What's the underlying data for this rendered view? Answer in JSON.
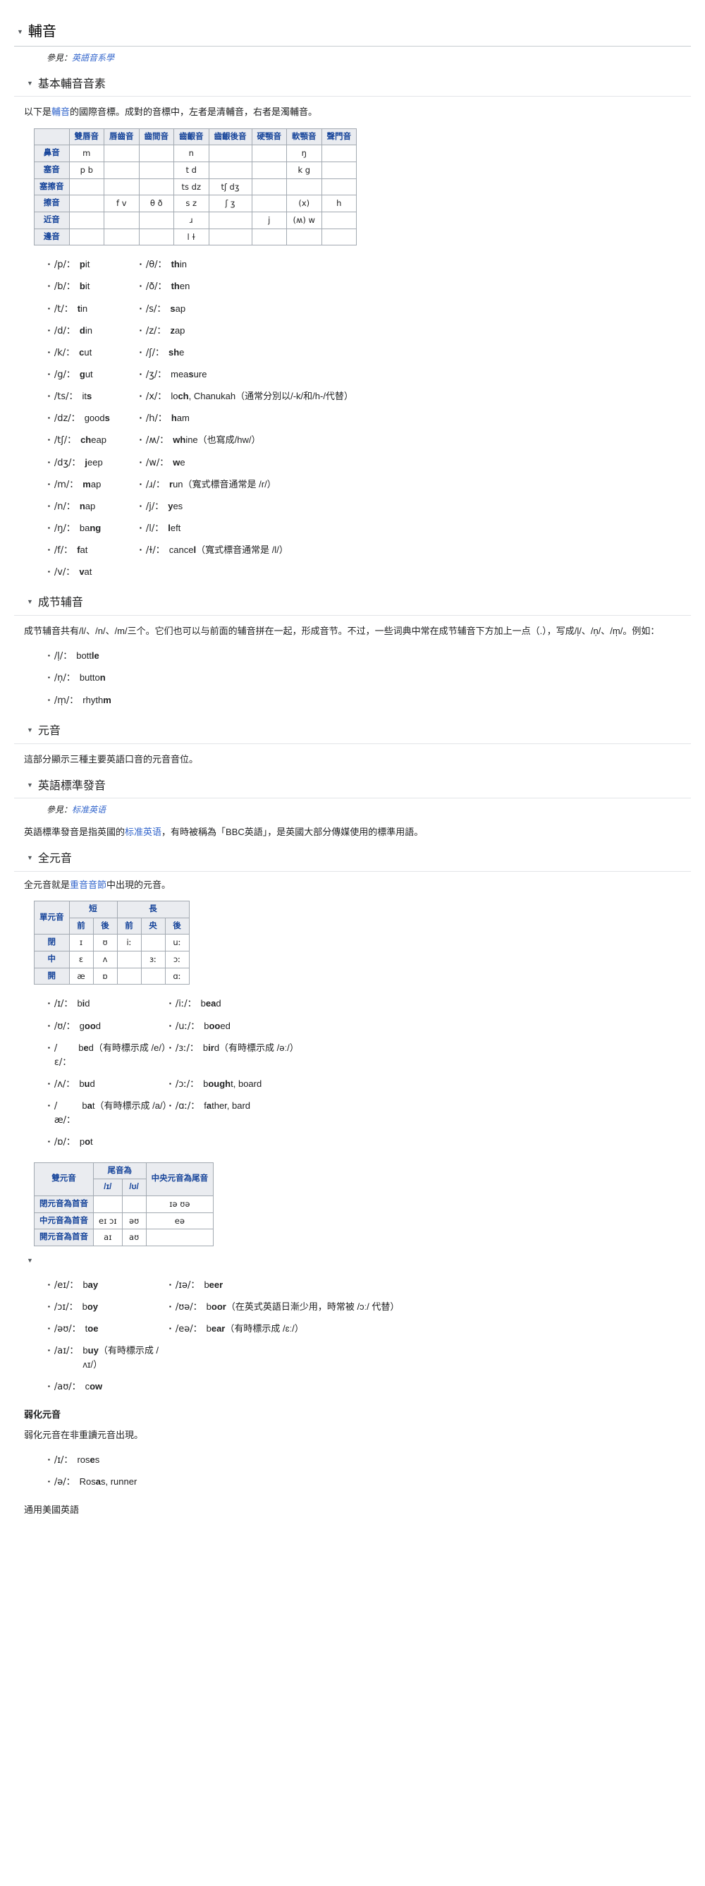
{
  "sections": {
    "consonants_title": "輔音",
    "hatnote_prefix": "參見：",
    "hatnote_link": "英語音系學",
    "basic_consonants_title": "基本輔音音素",
    "basic_consonants_intro_1": "以下是",
    "basic_consonants_intro_link": "輔音",
    "basic_consonants_intro_2": "的國際音標。成對的音標中，左者是清輔音，右者是濁輔音。",
    "syllabic_title": "成节辅音",
    "syllabic_para": "成节辅音共有/l/、/n/、/m/三个。它们也可以与前面的辅音拼在一起，形成音节。不过，一些词典中常在成节辅音下方加上一点（.），写成/l̩/、/n̩/、/m̩/。例如：",
    "vowels_title": "元音",
    "vowels_para": "這部分顯示三種主要英語口音的元音音位。",
    "rp_title": "英語標準發音",
    "rp_hatnote_prefix": "參見：",
    "rp_hatnote_link": "标准英语",
    "rp_para_1": "英語標準發音是指英國的",
    "rp_para_link": "标准英语",
    "rp_para_2": "，有時被稱為「BBC英語」，是英國大部分傳媒使用的標準用語。",
    "full_vowels_title": "全元音",
    "full_vowels_para_1": "全元音就是",
    "full_vowels_para_link": "重音音節",
    "full_vowels_para_2": "中出現的元音。",
    "weak_vowels_title": "弱化元音",
    "weak_vowels_para": "弱化元音在非重讀元音出現。",
    "ga_title": "通用美國英語"
  },
  "consonant_table": {
    "columns": [
      "雙唇音",
      "唇齒音",
      "齒間音",
      "齒齦音",
      "齒齦後音",
      "硬顎音",
      "軟顎音",
      "聲門音"
    ],
    "rows": [
      {
        "label": "鼻音",
        "cells": [
          "m",
          "",
          "",
          "n",
          "",
          "",
          "ŋ",
          ""
        ]
      },
      {
        "label": "塞音",
        "cells": [
          "p b",
          "",
          "",
          "t d",
          "",
          "",
          "k g",
          ""
        ]
      },
      {
        "label": "塞擦音",
        "cells": [
          "",
          "",
          "",
          "ts dz",
          "tʃ dʒ",
          "",
          "",
          ""
        ]
      },
      {
        "label": "擦音",
        "cells": [
          "",
          "f v",
          "θ ð",
          "s z",
          "ʃ ʒ",
          "",
          "(x)",
          "h"
        ]
      },
      {
        "label": "近音",
        "cells": [
          "",
          "",
          "",
          "ɹ",
          "",
          "j",
          "(ʍ) w",
          ""
        ]
      },
      {
        "label": "邊音",
        "cells": [
          "",
          "",
          "",
          "l ɫ",
          "",
          "",
          "",
          ""
        ]
      }
    ]
  },
  "consonant_examples": [
    {
      "left": {
        "ipa": "/p/：",
        "pre": "",
        "bold": "p",
        "post": "it"
      },
      "right": {
        "ipa": "/θ/：",
        "pre": "",
        "bold": "th",
        "post": "in"
      }
    },
    {
      "left": {
        "ipa": "/b/：",
        "pre": "",
        "bold": "b",
        "post": "it"
      },
      "right": {
        "ipa": "/ð/：",
        "pre": "",
        "bold": "th",
        "post": "en"
      }
    },
    {
      "left": {
        "ipa": "/t/：",
        "pre": "",
        "bold": "t",
        "post": "in"
      },
      "right": {
        "ipa": "/s/：",
        "pre": "",
        "bold": "s",
        "post": "ap"
      }
    },
    {
      "left": {
        "ipa": "/d/：",
        "pre": "",
        "bold": "d",
        "post": "in"
      },
      "right": {
        "ipa": "/z/：",
        "pre": "",
        "bold": "z",
        "post": "ap"
      }
    },
    {
      "left": {
        "ipa": "/k/：",
        "pre": "",
        "bold": "c",
        "post": "ut"
      },
      "right": {
        "ipa": "/ʃ/：",
        "pre": "",
        "bold": "sh",
        "post": "e"
      }
    },
    {
      "left": {
        "ipa": "/g/：",
        "pre": "",
        "bold": "g",
        "post": "ut"
      },
      "right": {
        "ipa": "/ʒ/：",
        "pre": "mea",
        "bold": "s",
        "post": "ure"
      }
    },
    {
      "left": {
        "ipa": "/ts/：",
        "pre": "it",
        "bold": "s",
        "post": ""
      },
      "right": {
        "ipa": "/x/：",
        "pre": "lo",
        "bold": "ch",
        "post": ", Chanukah（通常分別以/-k/和/h-/代替）"
      }
    },
    {
      "left": {
        "ipa": "/dz/：",
        "pre": "good",
        "bold": "s",
        "post": ""
      },
      "right": {
        "ipa": "/h/：",
        "pre": "",
        "bold": "h",
        "post": "am"
      }
    },
    {
      "left": {
        "ipa": "/tʃ/：",
        "pre": "",
        "bold": "ch",
        "post": "eap"
      },
      "right": {
        "ipa": "/ʍ/：",
        "pre": "",
        "bold": "wh",
        "post": "ine（也寫成/hw/）"
      }
    },
    {
      "left": {
        "ipa": "/dʒ/：",
        "pre": "",
        "bold": "j",
        "post": "eep"
      },
      "right": {
        "ipa": "/w/：",
        "pre": "",
        "bold": "w",
        "post": "e"
      }
    },
    {
      "left": {
        "ipa": "/m/：",
        "pre": "",
        "bold": "m",
        "post": "ap"
      },
      "right": {
        "ipa": "/ɹ/：",
        "pre": "",
        "bold": "r",
        "post": "un（寬式標音通常是 /r/）"
      }
    },
    {
      "left": {
        "ipa": "/n/：",
        "pre": "",
        "bold": "n",
        "post": "ap"
      },
      "right": {
        "ipa": "/j/：",
        "pre": "",
        "bold": "y",
        "post": "es"
      }
    },
    {
      "left": {
        "ipa": "/ŋ/：",
        "pre": "ba",
        "bold": "ng",
        "post": ""
      },
      "right": {
        "ipa": "/l/：",
        "pre": "",
        "bold": "l",
        "post": "eft"
      }
    },
    {
      "left": {
        "ipa": "/f/：",
        "pre": "",
        "bold": "f",
        "post": "at"
      },
      "right": {
        "ipa": "/ɫ/：",
        "pre": "cance",
        "bold": "l",
        "post": "（寬式標音通常是 /l/）"
      }
    },
    {
      "left": {
        "ipa": "/v/：",
        "pre": "",
        "bold": "v",
        "post": "at"
      },
      "right": null
    }
  ],
  "syllabic_examples": [
    {
      "ipa": "/l̩/：",
      "pre": "bott",
      "bold": "le",
      "post": ""
    },
    {
      "ipa": "/n̩/：",
      "pre": "butto",
      "bold": "n",
      "post": ""
    },
    {
      "ipa": "/m̩/：",
      "pre": "rhyth",
      "bold": "m",
      "post": ""
    }
  ],
  "monophthong_table": {
    "corner": "單元音",
    "group_short": "短",
    "group_long": "長",
    "sub_short": [
      "前",
      "後"
    ],
    "sub_long": [
      "前",
      "央",
      "後"
    ],
    "rows": [
      {
        "label": "閉",
        "cells": [
          "ɪ",
          "ʊ",
          "iː",
          "",
          "uː"
        ]
      },
      {
        "label": "中",
        "cells": [
          "ɛ",
          "ʌ",
          "",
          "ɜː",
          "ɔː"
        ]
      },
      {
        "label": "開",
        "cells": [
          "æ",
          "ɒ",
          "",
          "",
          "ɑː"
        ]
      }
    ]
  },
  "monophthong_examples": [
    {
      "left": {
        "ipa": "/ɪ/：",
        "pre": "b",
        "bold": "i",
        "post": "d"
      },
      "right": {
        "ipa": "/iː/：",
        "pre": "b",
        "bold": "ea",
        "post": "d"
      }
    },
    {
      "left": {
        "ipa": "/ʊ/：",
        "pre": "g",
        "bold": "oo",
        "post": "d"
      },
      "right": {
        "ipa": "/uː/：",
        "pre": "b",
        "bold": "oo",
        "post": "ed"
      }
    },
    {
      "left": {
        "ipa": "/ɛ/：",
        "pre": "b",
        "bold": "e",
        "post": "d（有時標示成 /e/）"
      },
      "right": {
        "ipa": "/ɜː/：",
        "pre": "b",
        "bold": "ir",
        "post": "d（有時標示成 /əː/）"
      }
    },
    {
      "left": {
        "ipa": "/ʌ/：",
        "pre": "b",
        "bold": "u",
        "post": "d"
      },
      "right": {
        "ipa": "/ɔː/：",
        "pre": "b",
        "bold": "ough",
        "post": "t, board"
      }
    },
    {
      "left": {
        "ipa": "/æ/：",
        "pre": "b",
        "bold": "a",
        "post": "t（有時標示成 /a/）"
      },
      "right": {
        "ipa": "/ɑː/：",
        "pre": "f",
        "bold": "a",
        "post": "ther, bard"
      }
    },
    {
      "left": {
        "ipa": "/ɒ/：",
        "pre": "p",
        "bold": "o",
        "post": "t"
      },
      "right": null
    }
  ],
  "diphthong_table": {
    "corner": "雙元音",
    "group_end": "尾音為",
    "group_center": "中央元音為尾音",
    "sub_end": [
      "/ɪ/",
      "/ʊ/"
    ],
    "rows": [
      {
        "label": "閉元音為首音",
        "cells": [
          "",
          "",
          "ɪə ʊə"
        ]
      },
      {
        "label": "中元音為首音",
        "cells": [
          "eɪ ɔɪ",
          "əʊ",
          "eə"
        ]
      },
      {
        "label": "開元音為首音",
        "cells": [
          "aɪ",
          "aʊ",
          ""
        ]
      }
    ]
  },
  "diphthong_examples": [
    {
      "left": {
        "ipa": "/eɪ/：",
        "pre": "b",
        "bold": "ay",
        "post": ""
      },
      "right": {
        "ipa": "/ɪə/：",
        "pre": "b",
        "bold": "eer",
        "post": ""
      }
    },
    {
      "left": {
        "ipa": "/ɔɪ/：",
        "pre": "b",
        "bold": "oy",
        "post": ""
      },
      "right": {
        "ipa": "/ʊə/：",
        "pre": "b",
        "bold": "oor",
        "post": "（在英式英語日漸少用，時常被 /ɔː/ 代替）"
      }
    },
    {
      "left": {
        "ipa": "/əʊ/：",
        "pre": "t",
        "bold": "oe",
        "post": ""
      },
      "right": {
        "ipa": "/eə/：",
        "pre": "b",
        "bold": "ear",
        "post": "（有時標示成 /ɛː/）"
      }
    },
    {
      "left": {
        "ipa": "/aɪ/：",
        "pre": "b",
        "bold": "uy",
        "post": "（有時標示成 /ʌɪ/）"
      },
      "right": null
    },
    {
      "left": {
        "ipa": "/aʊ/：",
        "pre": "c",
        "bold": "ow",
        "post": ""
      },
      "right": null
    }
  ],
  "weak_vowel_examples": [
    {
      "ipa": "/ɪ/：",
      "pre": "ros",
      "bold": "e",
      "post": "s"
    },
    {
      "ipa": "/ə/：",
      "pre": "Ros",
      "bold": "a",
      "post": "s, runner"
    }
  ]
}
